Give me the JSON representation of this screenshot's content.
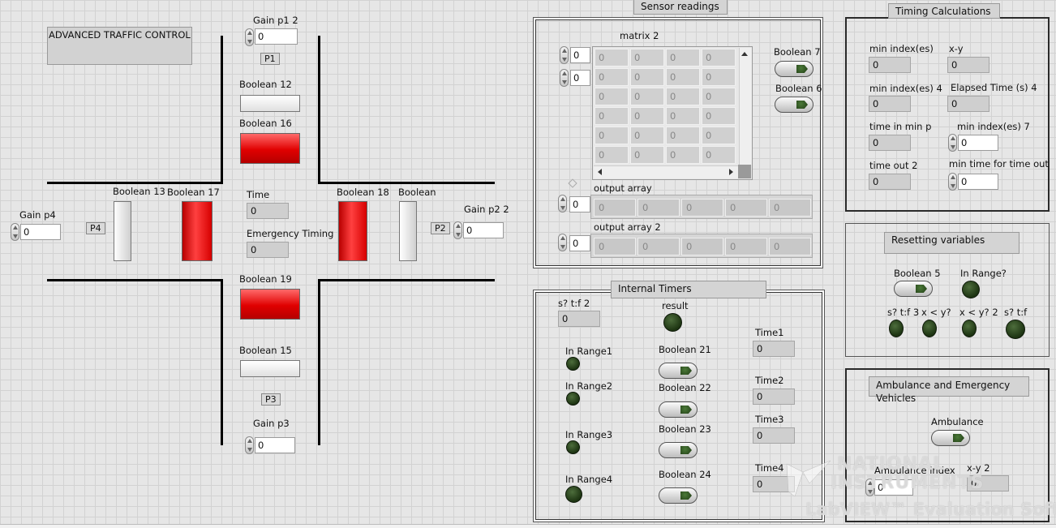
{
  "title": "ADVANCED TRAFFIC CONTROL",
  "intersection": {
    "gain_p1": {
      "label": "Gain p1 2",
      "value": "0"
    },
    "p1": "P1",
    "boolean12": "Boolean 12",
    "boolean16": "Boolean 16",
    "boolean13": "Boolean 13",
    "boolean17": "Boolean 17",
    "time_label": "Time",
    "time_value": "0",
    "emergency_label": "Emergency Timing",
    "emergency_value": "0",
    "boolean18": "Boolean 18",
    "boolean": "Boolean",
    "gain_p2": {
      "label": "Gain p2 2",
      "value": "0"
    },
    "p2": "P2",
    "gain_p4": {
      "label": "Gain p4",
      "value": "0"
    },
    "p4": "P4",
    "boolean19": "Boolean 19",
    "boolean15": "Boolean 15",
    "p3": "P3",
    "gain_p3": {
      "label": "Gain p3",
      "value": "0"
    }
  },
  "sensor": {
    "caption": "Sensor readings",
    "matrix_label": "matrix 2",
    "row_index": "0",
    "col_index": "0",
    "matrix": [
      [
        "0",
        "0",
        "0",
        "0"
      ],
      [
        "0",
        "0",
        "0",
        "0"
      ],
      [
        "0",
        "0",
        "0",
        "0"
      ],
      [
        "0",
        "0",
        "0",
        "0"
      ],
      [
        "0",
        "0",
        "0",
        "0"
      ],
      [
        "0",
        "0",
        "0",
        "0"
      ]
    ],
    "boolean7": "Boolean 7",
    "boolean6": "Boolean 6",
    "output_array_label": "output array",
    "output_array_index": "0",
    "output_array": [
      "0",
      "0",
      "0",
      "0",
      "0"
    ],
    "output_array2_label": "output array 2",
    "output_array2_index": "0",
    "output_array2": [
      "0",
      "0",
      "0",
      "0",
      "0"
    ]
  },
  "timers": {
    "caption": "Internal Timers",
    "stf2_label": "s? t:f 2",
    "stf2_value": "0",
    "result": "result",
    "ranges": [
      "In Range1",
      "In Range2",
      "In Range3",
      "In Range4"
    ],
    "booleans": [
      "Boolean 21",
      "Boolean 22",
      "Boolean 23",
      "Boolean 24"
    ],
    "times": [
      {
        "label": "Time1",
        "value": "0"
      },
      {
        "label": "Time2",
        "value": "0"
      },
      {
        "label": "Time3",
        "value": "0"
      },
      {
        "label": "Time4",
        "value": "0"
      }
    ]
  },
  "timing": {
    "caption": "Timing Calculations",
    "min_index": {
      "label": "min index(es)",
      "value": "0"
    },
    "xy": {
      "label": "x-y",
      "value": "0"
    },
    "min_index4": {
      "label": "min index(es) 4",
      "value": "0"
    },
    "elapsed4": {
      "label": "Elapsed Time (s) 4",
      "value": "0"
    },
    "time_in_min": {
      "label": "time in min p",
      "value": "0"
    },
    "min_index7": {
      "label": "min index(es) 7",
      "value": "0"
    },
    "time_out2": {
      "label": "time out 2",
      "value": "0"
    },
    "min_time_out": {
      "label": "min time for time out",
      "value": "0"
    }
  },
  "resetting": {
    "caption": "Resetting variables",
    "boolean5": "Boolean 5",
    "in_range": "In Range?",
    "stf3": "s? t:f 3",
    "xy_lt": "x < y?",
    "xy_lt2": "x < y? 2",
    "stf": "s? t:f"
  },
  "ambulance": {
    "caption": "Ambulance and Emergency Vehicles",
    "ambulance": "Ambulance",
    "index_label": "Ambulance index",
    "index_value": "0",
    "xy2_label": "x-y 2",
    "xy2_value": "0"
  },
  "watermark": {
    "line1": "NATIONAL",
    "line2": "INSTRUMENTS",
    "line3": "LabVIEW™ Evaluation Software"
  }
}
